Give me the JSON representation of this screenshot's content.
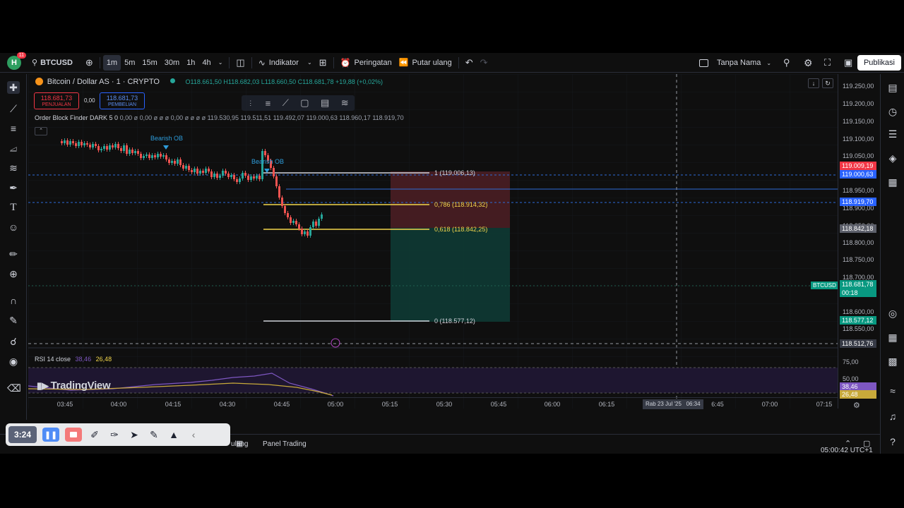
{
  "topbar": {
    "avatar_letter": "H",
    "notif_count": "11",
    "symbol": "BTCUSD",
    "timeframes": [
      "1m",
      "5m",
      "15m",
      "30m",
      "1h",
      "4h"
    ],
    "indicators_label": "Indikator",
    "alerts_label": "Peringatan",
    "replay_label": "Putar ulang",
    "layout_name": "Tanpa Nama",
    "publish_label": "Publikasi"
  },
  "legend": {
    "title": "Bitcoin / Dollar AS · 1 · CRYPTO",
    "ohlc": "O118.661,50 H118.682,03 L118.660,50 C118.681,78 +19,88 (+0,02%)",
    "sell_price": "118.681,73",
    "sell_label": "PENJUALAN",
    "spread": "0,00",
    "buy_price": "118.681,73",
    "buy_label": "PEMBELIAN",
    "indicator_name": "Order Block Finder DARK 5 0",
    "indicator_values": "0,00 ø 0,00 ø ø ø 0,00 ø ø ø ø 119.530,95 119.511,51 119.492,07 119.000,63 118.960,17 118.919,70"
  },
  "annotations": {
    "ob1": "Bearish OB",
    "ob2": "Bearish OB",
    "fib_1": "1 (119.006,13)",
    "fib_786": "0,786 (118.914,32)",
    "fib_618": "0,618 (118.842,25)",
    "fib_0": "0 (118.577,12)"
  },
  "price_scale": {
    "labels": [
      "119.250,00",
      "119.200,00",
      "119.150,00",
      "119.100,00",
      "119.050,00",
      "118.950,00",
      "118.900,00",
      "118.850,00",
      "118.800,00",
      "118.750,00",
      "118.700,00",
      "118.600,00",
      "118.550,00"
    ],
    "tag_red": "119.009,19",
    "tag_blue1": "119.000,63",
    "tag_blue2": "118.919,70",
    "tag_grey": "118.842,18",
    "tag_last": "118.681,78",
    "tag_countdown": "00:18",
    "tag_symbol": "BTCUSD",
    "tag_green": "118.577,12",
    "tag_cross": "118.512,76",
    "rsi_75": "75,00",
    "rsi_50": "50,00",
    "rsi_val": "38,46",
    "rsi_val2": "26,48"
  },
  "rsi": {
    "label": "RSI 14 close",
    "v1": "38,46",
    "v2": "26,48"
  },
  "watermark": "TradingView",
  "time_axis": {
    "labels": [
      "03:45",
      "04:00",
      "04:15",
      "04:30",
      "04:45",
      "05:00",
      "05:15",
      "05:30",
      "05:45",
      "06:00",
      "06:15",
      "07:00",
      "07:15"
    ],
    "cross_label": "Rab 23 Jul '25   06:34",
    "partial": "6:45"
  },
  "bottom": {
    "clock": "05:00:42 UTC+1",
    "tab_replay_partial": "ulang",
    "tab_trading": "Panel Trading"
  },
  "recorder": {
    "time": "3:24"
  },
  "colors": {
    "bull": "#26a69a",
    "bear": "#ef5350",
    "fib_yellow": "#f2d64b",
    "ob_blue": "#2d9cdb"
  }
}
